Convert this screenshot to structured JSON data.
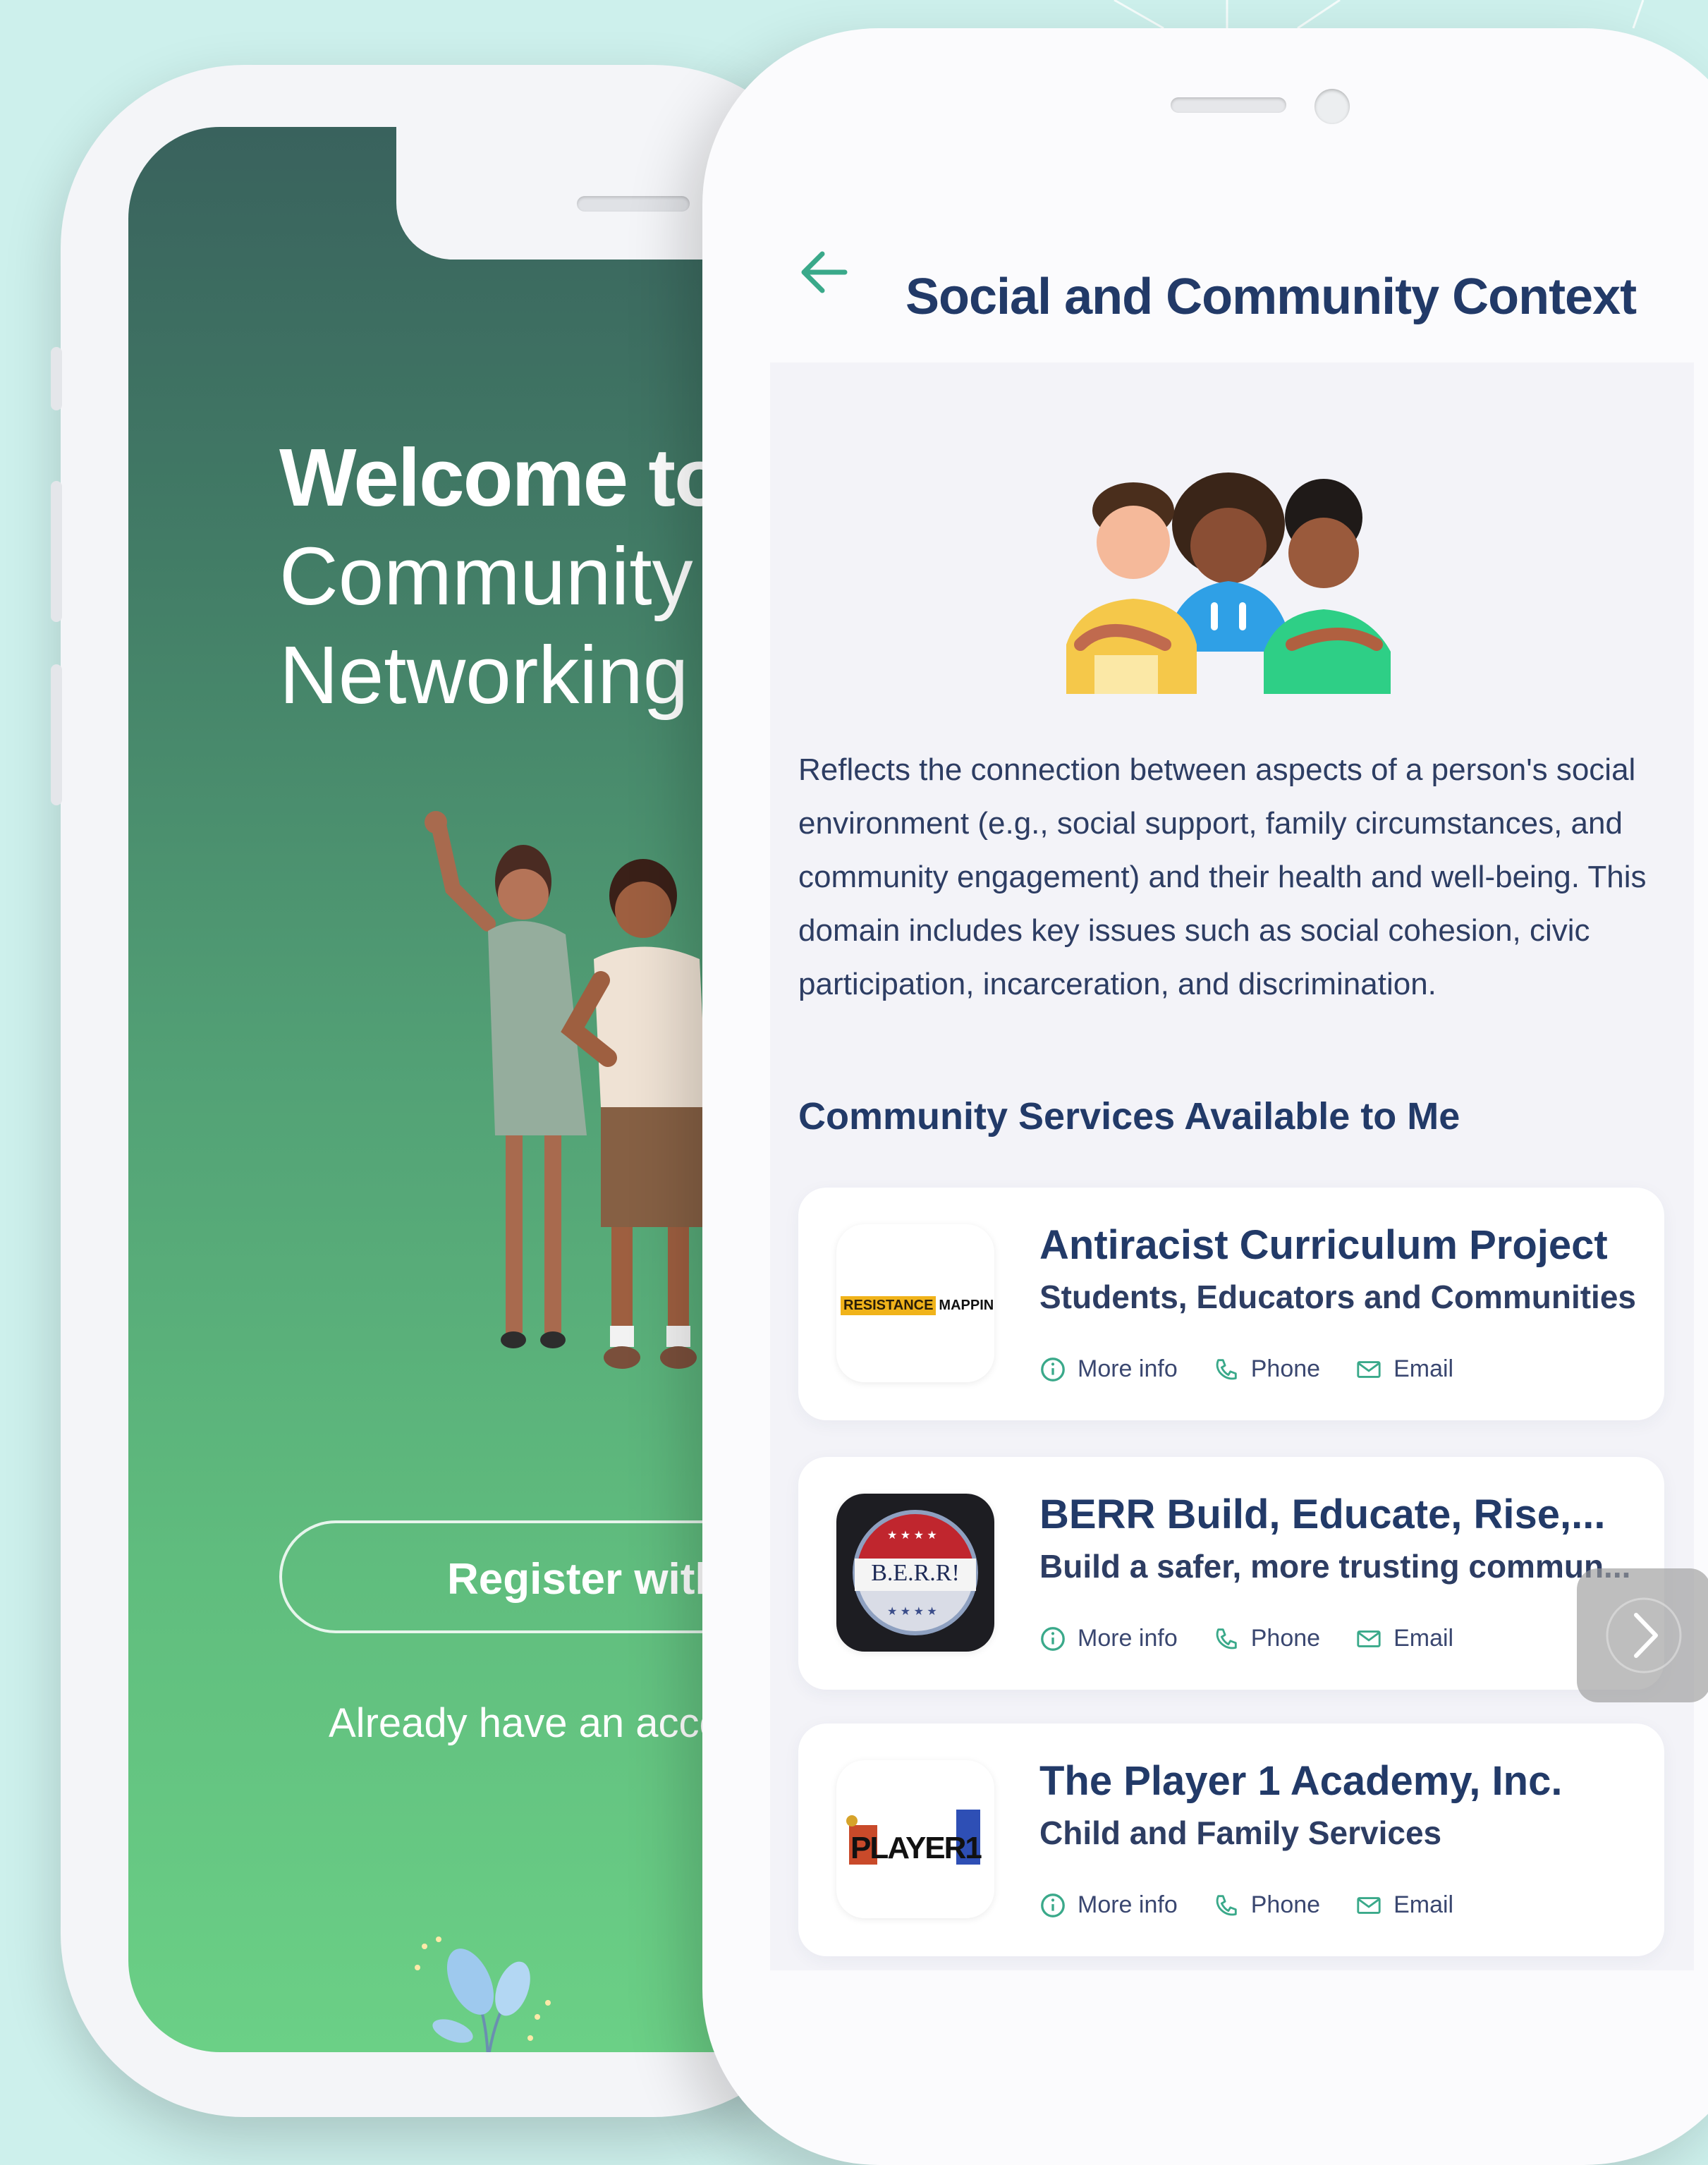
{
  "welcome": {
    "title": "Welcome to",
    "line2": "Community",
    "line3": "Networking H",
    "register_label": "Register with Em",
    "login_prompt": "Already have an account"
  },
  "detail": {
    "title": "Social and Community Context",
    "description": "Reflects the connection between aspects of a person's social environment (e.g., social support, family circumstances, and community engagement) and their health and well-being. This domain includes key issues such as social cohesion, civic participation, incarceration, and discrimination.",
    "section_title": "Community Services Available to Me",
    "actions": {
      "more_info": "More info",
      "phone": "Phone",
      "email": "Email"
    },
    "services": [
      {
        "name": "Antiracist Curriculum Project",
        "subtitle": "Students, Educators and Communities",
        "logo_text_a": "RESISTANCE",
        "logo_text_b": "MAPPING"
      },
      {
        "name": "BERR Build, Educate, Rise,...",
        "subtitle": "Build a safer, more trusting commun...",
        "logo_text": "B.E.R.R!"
      },
      {
        "name": "The Player 1 Academy, Inc.",
        "subtitle": "Child and Family Services",
        "logo_text": "PLAYER1"
      }
    ]
  },
  "colors": {
    "background": "#cdf0ec",
    "brand_green": "#3aa98a",
    "title_navy": "#223a68"
  },
  "icons": [
    "arrow-left-icon",
    "info-icon",
    "phone-icon",
    "mail-icon",
    "chevron-right-icon"
  ]
}
